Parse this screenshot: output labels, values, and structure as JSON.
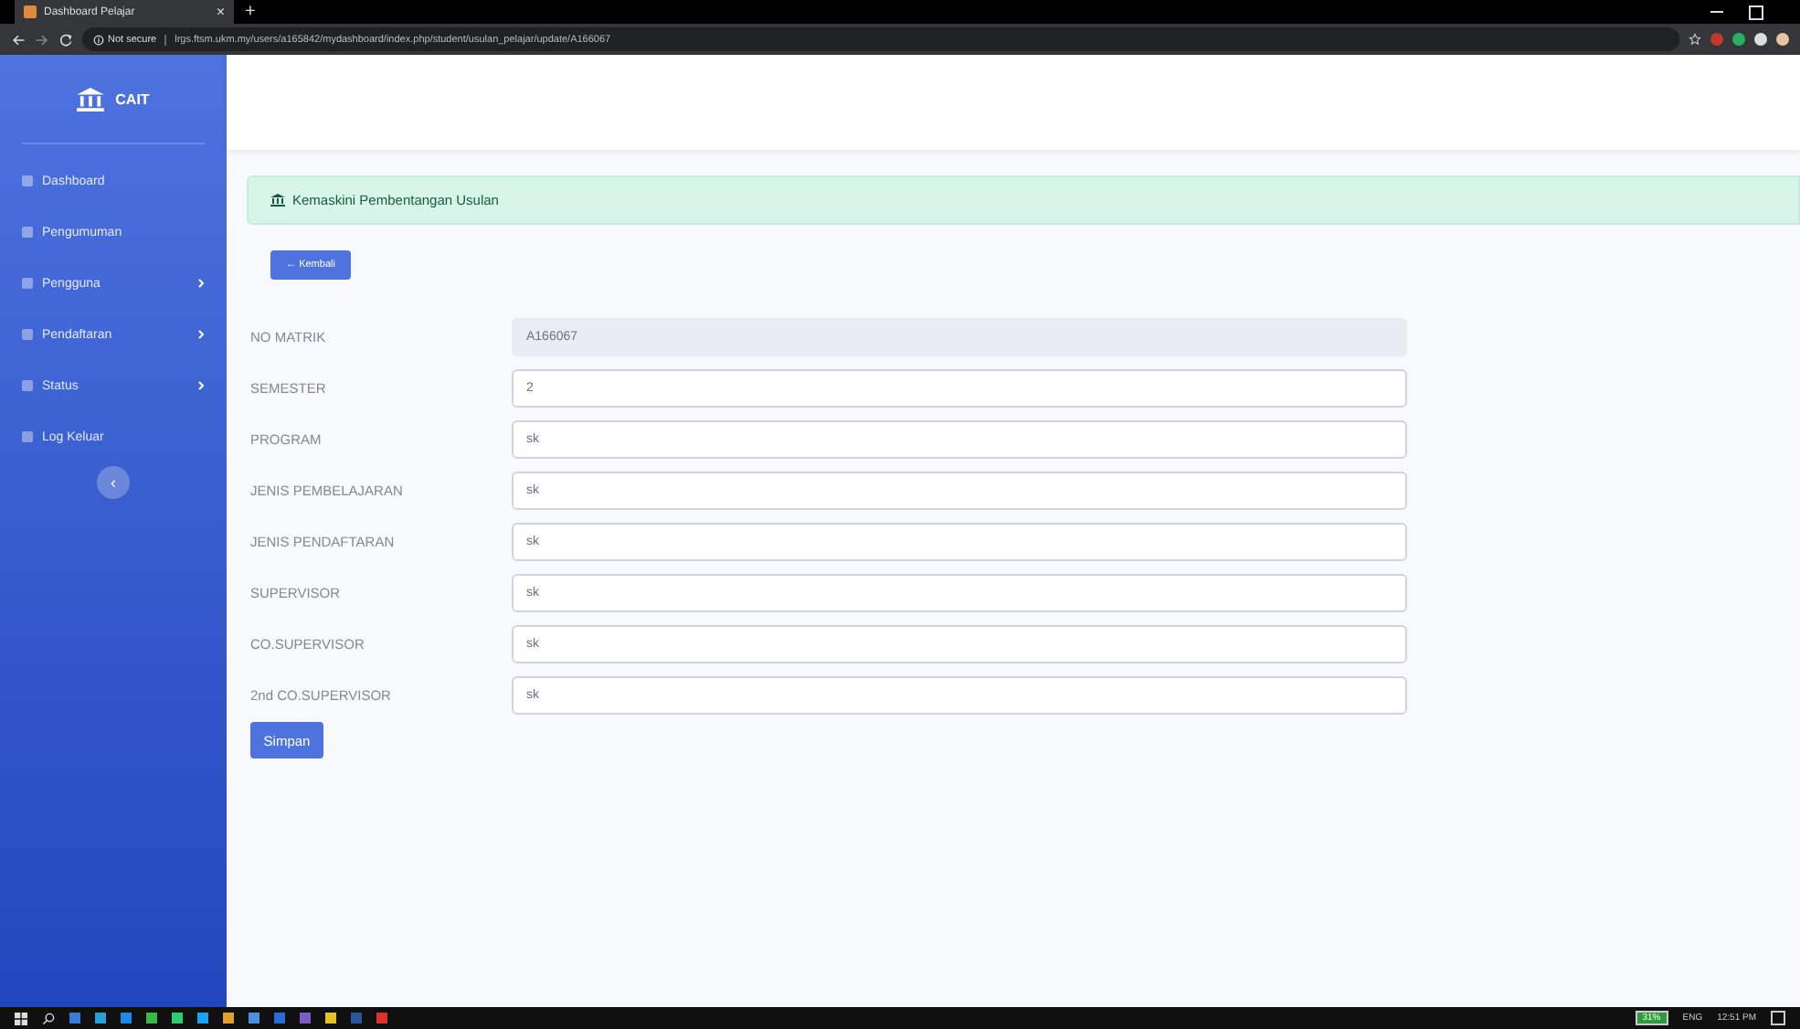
{
  "browser": {
    "tab_title": "Dashboard Pelajar",
    "tab_close": "×",
    "new_tab": "+",
    "security": "Not secure",
    "url": "lrgs.ftsm.ukm.my/users/a165842/mydashboard/index.php/student/usulan_pelajar/update/A166067"
  },
  "sidebar": {
    "brand": "CAIT",
    "items": [
      {
        "label": "Dashboard",
        "has_submenu": false
      },
      {
        "label": "Pengumuman",
        "has_submenu": false
      },
      {
        "label": "Pengguna",
        "has_submenu": true
      },
      {
        "label": "Pendaftaran",
        "has_submenu": true
      },
      {
        "label": "Status",
        "has_submenu": true
      },
      {
        "label": "Log Keluar",
        "has_submenu": false
      }
    ],
    "collapse": "‹"
  },
  "alert": "Kemaskini Pembentangan Usulan",
  "back_button": "← Kembali",
  "form": [
    {
      "label": "NO MATRIK",
      "value": "A166067",
      "disabled": true
    },
    {
      "label": "SEMESTER",
      "value": "2",
      "disabled": false
    },
    {
      "label": "PROGRAM",
      "value": "sk",
      "disabled": false
    },
    {
      "label": "JENIS PEMBELAJARAN",
      "value": "sk",
      "disabled": false
    },
    {
      "label": "JENIS PENDAFTARAN",
      "value": "sk",
      "disabled": false
    },
    {
      "label": "SUPERVISOR",
      "value": "sk",
      "disabled": false
    },
    {
      "label": "CO.SUPERVISOR",
      "value": "sk",
      "disabled": false
    },
    {
      "label": "2nd CO.SUPERVISOR",
      "value": "sk",
      "disabled": false
    }
  ],
  "save_button": "Simpan",
  "taskbar": {
    "battery": "31%",
    "language": "ENG",
    "time": "12:51 PM"
  }
}
